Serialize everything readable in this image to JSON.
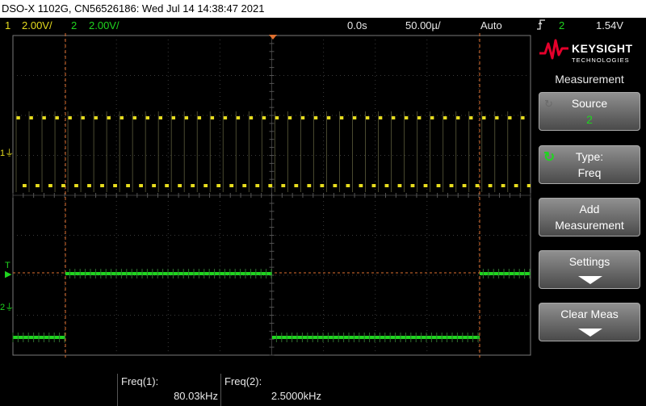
{
  "title": "DSO-X 1102G, CN56526186: Wed Jul 14 14:38:47 2021",
  "status": {
    "ch1_num": "1",
    "ch1_scale": "2.00V/",
    "ch2_num": "2",
    "ch2_scale": "2.00V/",
    "time_delay": "0.0s",
    "time_scale": "50.00µ/",
    "trigger_mode": "Auto",
    "trigger_icon": "trigger-edge-icon",
    "trigger_source": "2",
    "trigger_level": "1.54V"
  },
  "markers": {
    "ch1": "1",
    "trigger": "T",
    "ch2": "2"
  },
  "brand": {
    "name": "KEYSIGHT",
    "sub": "TECHNOLOGIES",
    "color": "#e4002b"
  },
  "panel": {
    "title": "Measurement",
    "softkeys": [
      {
        "l1": "Source",
        "l2": "2"
      },
      {
        "l1": "Type:",
        "l2": "Freq"
      },
      {
        "l1": "Add",
        "l2": "Measurement"
      },
      {
        "l1": "Settings",
        "l2": ""
      },
      {
        "l1": "Clear Meas",
        "l2": ""
      }
    ]
  },
  "measurements": [
    {
      "label": "Freq(1):",
      "value": "80.03kHz"
    },
    {
      "label": "Freq(2):",
      "value": "2.5000kHz"
    }
  ],
  "colors": {
    "ch1": "#e6dc1e",
    "ch2": "#1fd61f",
    "cursor": "#e07030"
  },
  "signals": {
    "ch1_freq_khz": 80.03,
    "ch2_freq_khz": 2.5,
    "duty_cycle": 0.5
  }
}
